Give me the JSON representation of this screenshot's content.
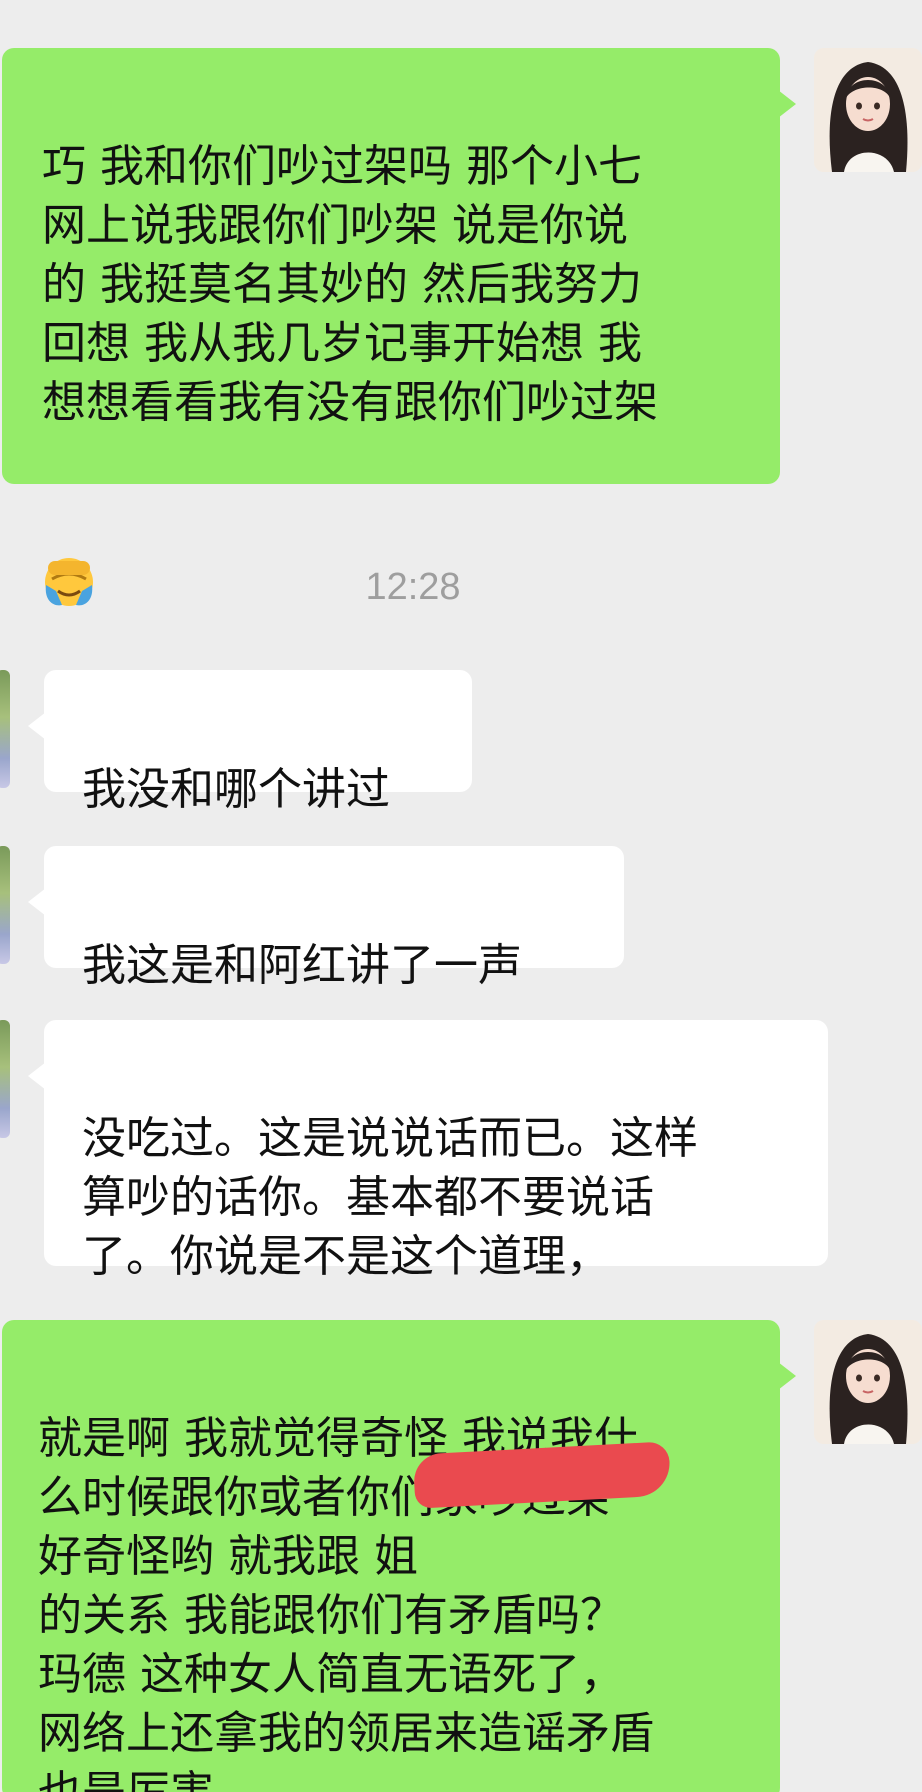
{
  "messages": [
    {
      "side": "sent",
      "text": "巧 我和你们吵过架吗 那个小七\n网上说我跟你们吵架 说是你说\n的 我挺莫名其妙的 然后我努力\n回想 我从我几岁记事开始想 我\n想想看看我有没有跟你们吵过架",
      "emoji": "face-palm-crying-emoji"
    },
    {
      "side": "recv",
      "text": "我没和哪个讲过"
    },
    {
      "side": "recv",
      "text": "我这是和阿红讲了一声"
    },
    {
      "side": "recv",
      "text": "没吃过。这是说说话而已。这样\n算吵的话你。基本都不要说话\n了。你说是不是这个道理，"
    },
    {
      "side": "sent",
      "text": "就是啊 我就觉得奇怪 我说我什\n么时候跟你或者你们家吵过架\n好奇怪哟 就我跟                  姐\n的关系 我能跟你们有矛盾吗？\n玛德 这种女人简直无语死了，\n网络上还拿我的领居来造谣矛盾\n也是厉害"
    }
  ],
  "timestamp": "12:28",
  "colors": {
    "sent_bubble": "#95ec69",
    "recv_bubble": "#ffffff",
    "background": "#ededed",
    "timestamp": "#9e9e9e",
    "redaction": "#ea4a4f"
  }
}
